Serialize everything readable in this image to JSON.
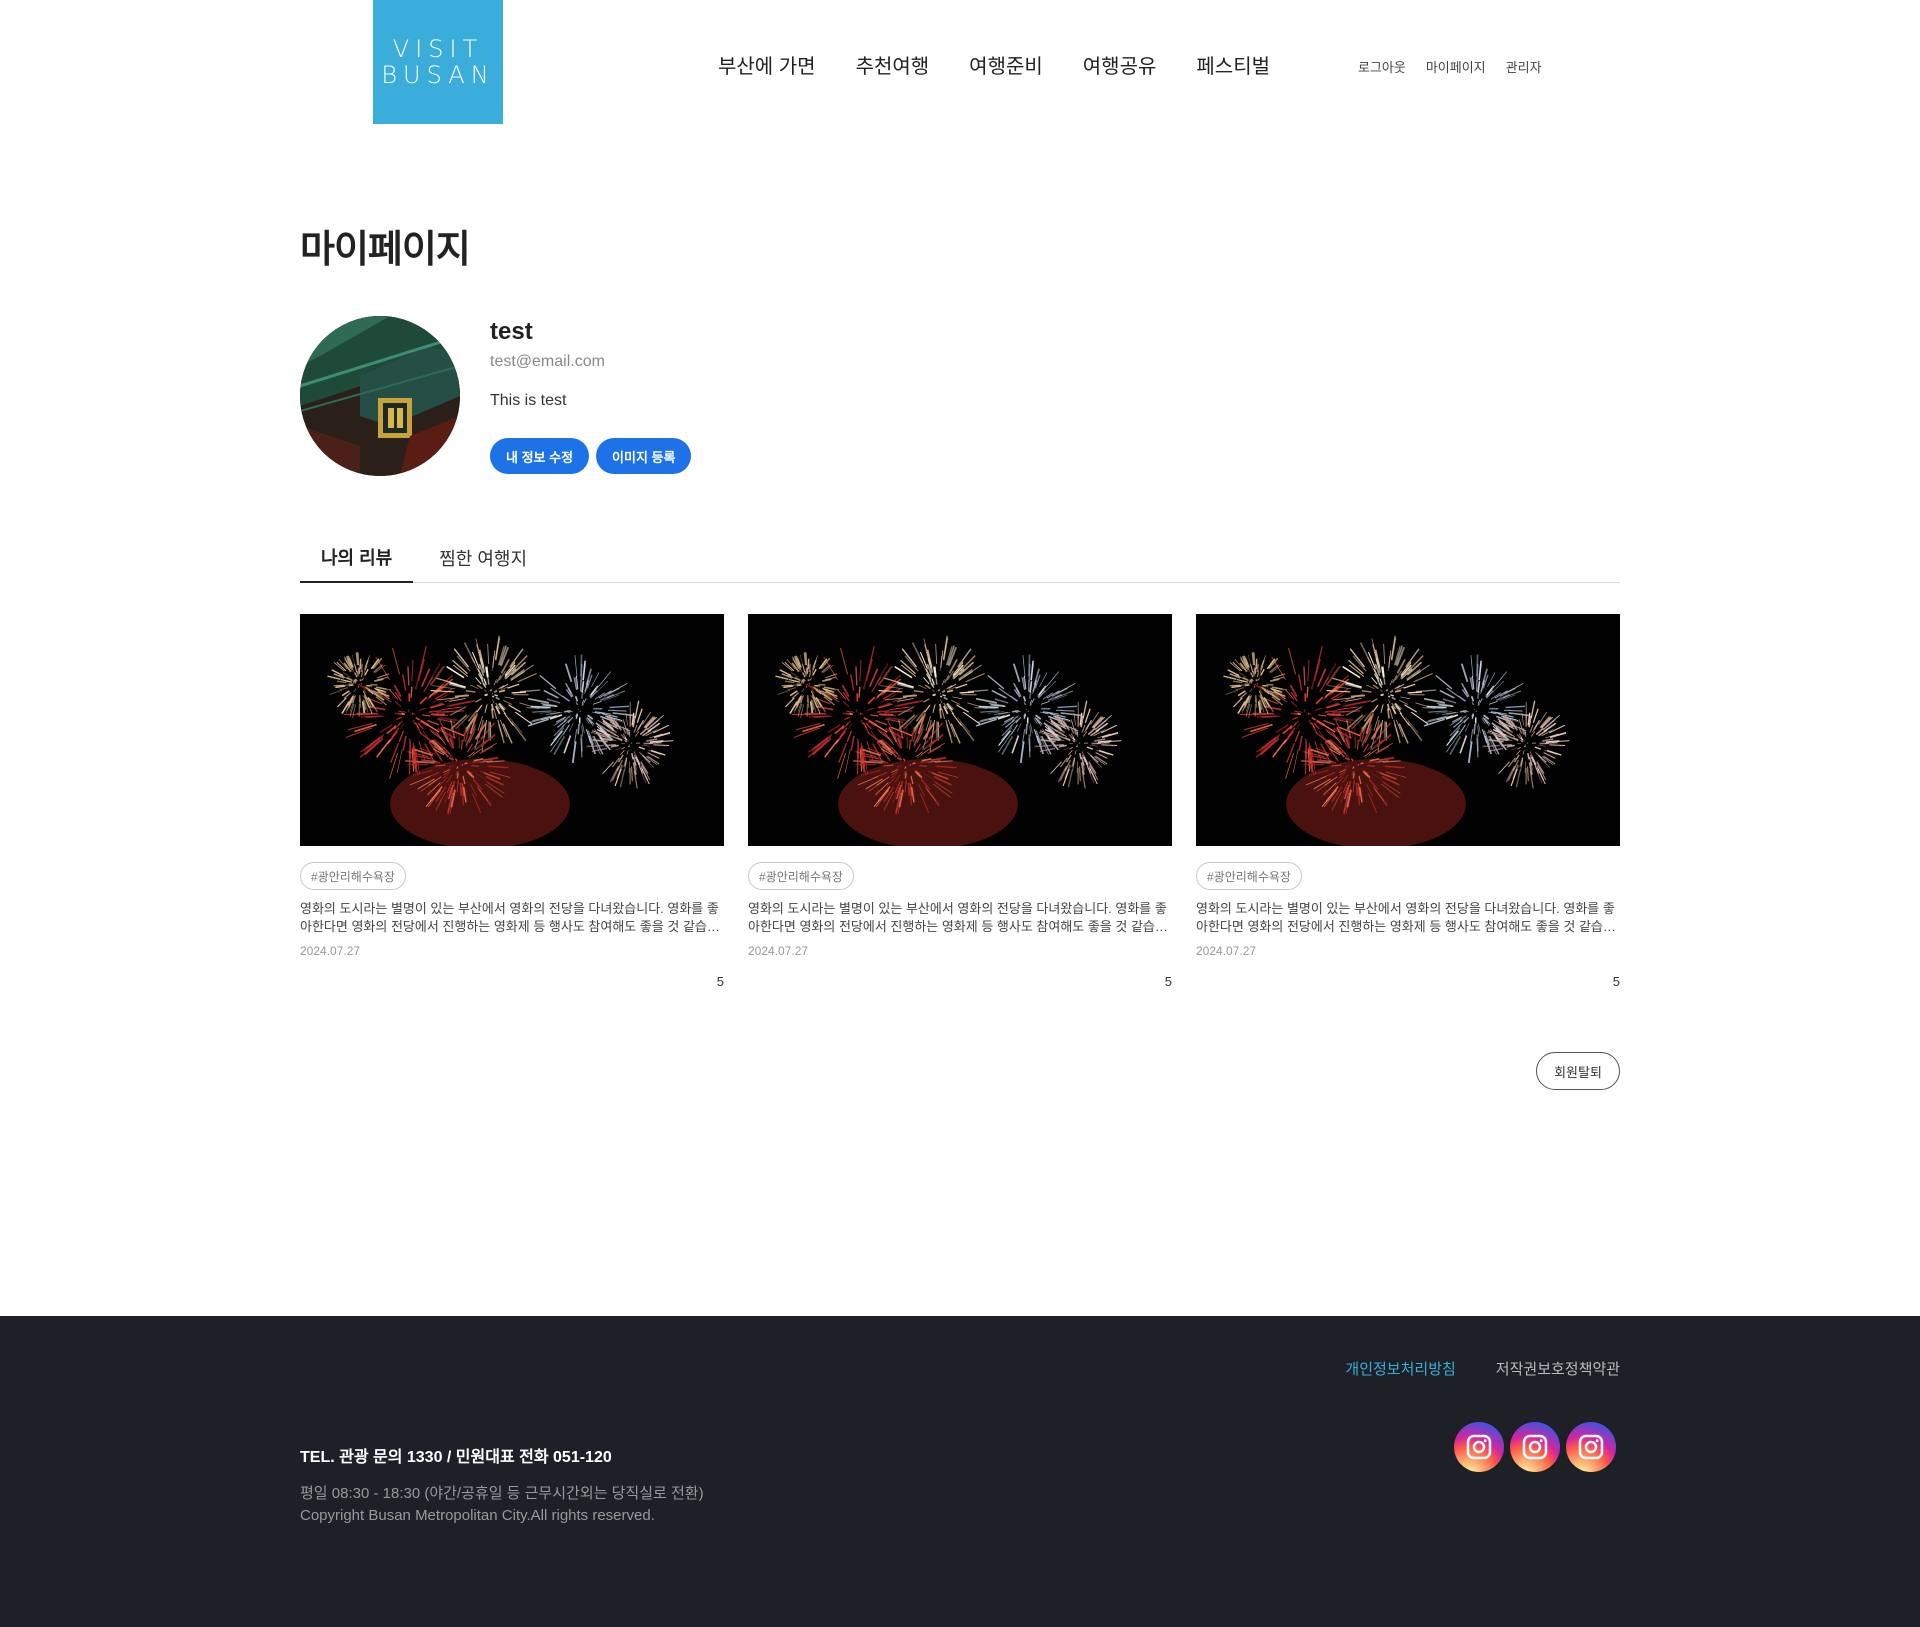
{
  "header": {
    "logo_line1": "VISIT",
    "logo_line2": "BUSAN",
    "nav": [
      "부산에 가면",
      "추천여행",
      "여행준비",
      "여행공유",
      "페스티벌"
    ],
    "util": [
      "로그아웃",
      "마이페이지",
      "관리자"
    ]
  },
  "page": {
    "title": "마이페이지"
  },
  "profile": {
    "name": "test",
    "email": "test@email.com",
    "bio": "This is test",
    "edit_button": "내 정보 수정",
    "image_button": "이미지 등록"
  },
  "tabs": [
    "나의 리뷰",
    "찜한 여행지"
  ],
  "reviews": [
    {
      "tag": "#광안리해수욕장",
      "text": "영화의 도시라는 별명이 있는 부산에서 영화의 전당을 다녀왔습니다. 영화를 좋아한다면 영화의 전당에서 진행하는 영화제 등 행사도 참여해도 좋을 것 같습니다.",
      "date": "2024.07.27",
      "count": "5"
    },
    {
      "tag": "#광안리해수욕장",
      "text": "영화의 도시라는 별명이 있는 부산에서 영화의 전당을 다녀왔습니다. 영화를 좋아한다면 영화의 전당에서 진행하는 영화제 등 행사도 참여해도 좋을 것 같습니다.",
      "date": "2024.07.27",
      "count": "5"
    },
    {
      "tag": "#광안리해수욕장",
      "text": "영화의 도시라는 별명이 있는 부산에서 영화의 전당을 다녀왔습니다. 영화를 좋아한다면 영화의 전당에서 진행하는 영화제 등 행사도 참여해도 좋을 것 같습니다.",
      "date": "2024.07.27",
      "count": "5"
    }
  ],
  "withdraw_button": "회원탈퇴",
  "footer": {
    "links": [
      "개인정보처리방침",
      "저작권보호정책약관"
    ],
    "tel": "TEL. 관광 문의 1330 / 민원대표 전화 051-120",
    "hours": "평일 08:30 - 18:30 (야간/공휴일 등 근무시간외는 당직실로 전환)",
    "copyright": "Copyright Busan Metropolitan City.All rights reserved.",
    "sns_icons": [
      "instagram-icon",
      "instagram-icon",
      "instagram-icon"
    ]
  },
  "colors": {
    "brand": "#3aaddb",
    "primary_button": "#1d72e8",
    "footer_bg": "#1e2027"
  }
}
